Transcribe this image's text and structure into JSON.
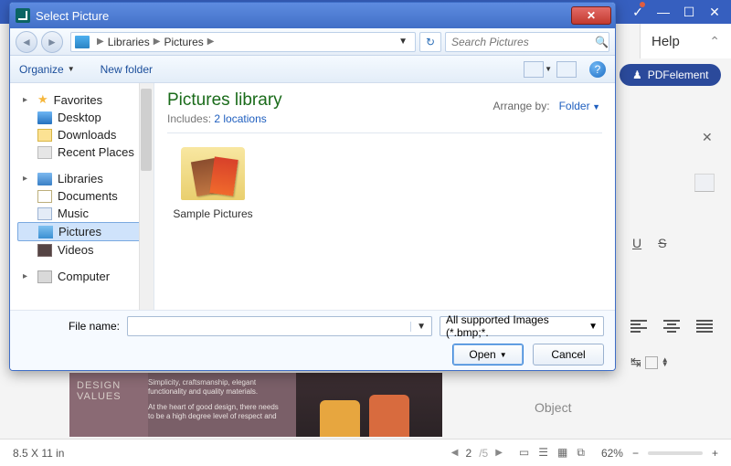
{
  "bg": {
    "help_label": "Help",
    "pdfe_btn": "PDFelement",
    "object_label": "Object"
  },
  "status": {
    "dims": "8.5 X 11 in",
    "page_cur": "2",
    "page_total": "/5",
    "zoom": "62%"
  },
  "doc": {
    "heading": "DESIGN VALUES",
    "p1": "Simplicity, craftsmanship, elegant functionality and quality materials.",
    "p2": "At the heart of good design, there needs to be a high degree level of respect and"
  },
  "dlg": {
    "title": "Select Picture",
    "crumbs": {
      "root": "Libraries",
      "sub": "Pictures"
    },
    "search_ph": "Search Pictures",
    "toolbar": {
      "organize": "Organize",
      "newfolder": "New folder"
    },
    "tree": {
      "favorites": "Favorites",
      "desktop": "Desktop",
      "downloads": "Downloads",
      "recent": "Recent Places",
      "libraries": "Libraries",
      "documents": "Documents",
      "music": "Music",
      "pictures": "Pictures",
      "videos": "Videos",
      "computer": "Computer"
    },
    "content": {
      "title": "Pictures library",
      "includes_pre": "Includes:  ",
      "includes_link": "2 locations",
      "arrange_by": "Arrange by:",
      "arrange_val": "Folder",
      "item_name": "Sample Pictures"
    },
    "filename_label": "File name:",
    "filetype": "All supported Images (*.bmp;*.",
    "open": "Open",
    "cancel": "Cancel"
  }
}
